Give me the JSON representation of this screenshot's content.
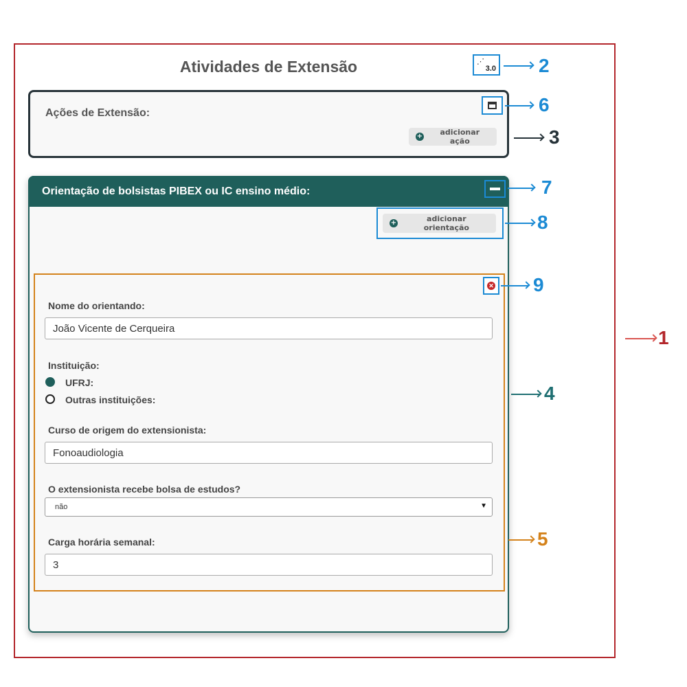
{
  "page": {
    "title": "Atividades de Extensão",
    "version": "3.0"
  },
  "acoes": {
    "title": "Ações de Extensão:",
    "add_label": "adicionar ação"
  },
  "orientacao": {
    "title": "Orientação de bolsistas PIBEX ou IC ensino médio:",
    "add_label": "adicionar orientação",
    "form": {
      "nome_label": "Nome do orientando:",
      "nome_value": "João Vicente de Cerqueira",
      "instituicao_label": "Instituição:",
      "instituicao_options": [
        {
          "label": "UFRJ:",
          "selected": true
        },
        {
          "label": "Outras instituições:",
          "selected": false
        }
      ],
      "curso_label": "Curso de origem do extensionista:",
      "curso_value": "Fonoaudiologia",
      "bolsa_label": "O extensionista recebe bolsa de estudos?",
      "bolsa_value": "não",
      "carga_label": "Carga horária semanal:",
      "carga_value": "3"
    }
  },
  "callouts": [
    "1",
    "2",
    "3",
    "4",
    "5",
    "6",
    "7",
    "8",
    "9"
  ],
  "colors": {
    "frame_red": "#b3262b",
    "callout_blue": "#1b8ad4",
    "teal": "#1f5f5b",
    "orange": "#d4821b",
    "dark": "#263238"
  }
}
